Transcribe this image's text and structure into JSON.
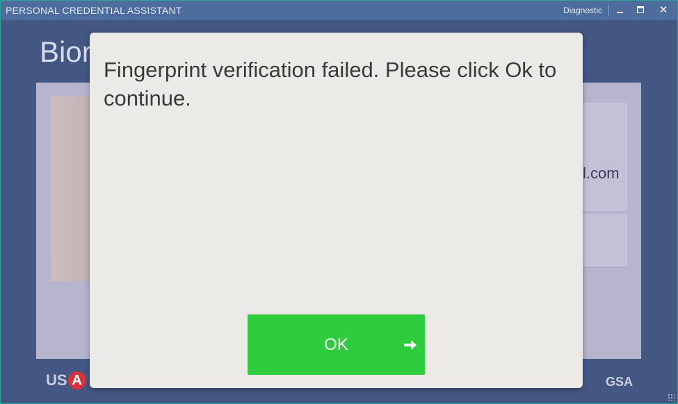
{
  "window": {
    "title": "PERSONAL CREDENTIAL ASSISTANT",
    "diagnostic_label": "Diagnostic",
    "minimize_icon": "minimize-icon",
    "maximize_icon": "maximize-icon",
    "close_icon": "close-icon",
    "close_glyph": "✕"
  },
  "background": {
    "heading": "Bior",
    "email_fragment": "l.com",
    "usa_logo": "US",
    "usa_logo_letter": "A",
    "gsa_logo": "GSA"
  },
  "dialog": {
    "message": "Fingerprint verification failed.  Please click Ok to continue.",
    "ok_label": "OK",
    "ok_icon": "arrow-right-icon",
    "ok_color": "#2ecc3e"
  }
}
